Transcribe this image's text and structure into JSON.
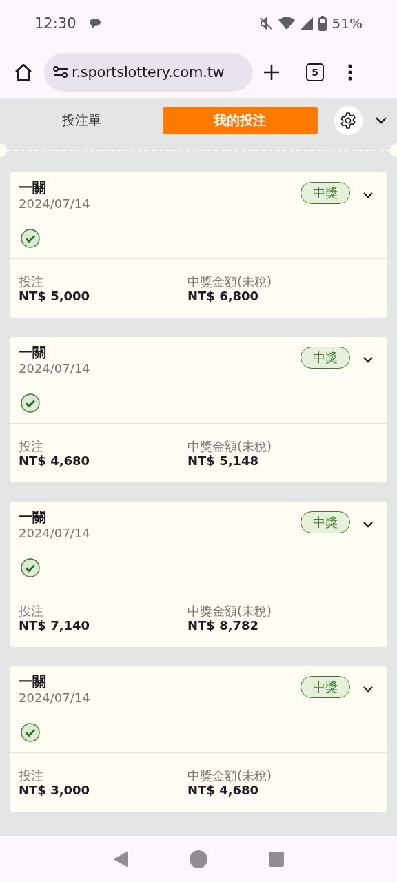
{
  "status_bar": {
    "time": "12:30",
    "battery": "51%"
  },
  "browser": {
    "url": "r.sportslottery.com.tw",
    "tab_count": "5"
  },
  "tabs": [
    {
      "label": "投注單",
      "selected": false
    },
    {
      "label": "我的投注",
      "selected": true
    }
  ],
  "bets": [
    {
      "title": "一關",
      "date": "2024/07/14",
      "status": "中獎",
      "stake_label": "投注",
      "stake": "NT$ 5,000",
      "payout_label": "中獎金額(未稅)",
      "payout": "NT$ 6,800"
    },
    {
      "title": "一關",
      "date": "2024/07/14",
      "status": "中獎",
      "stake_label": "投注",
      "stake": "NT$ 4,680",
      "payout_label": "中獎金額(未稅)",
      "payout": "NT$ 5,148"
    },
    {
      "title": "一關",
      "date": "2024/07/14",
      "status": "中獎",
      "stake_label": "投注",
      "stake": "NT$ 7,140",
      "payout_label": "中獎金額(未稅)",
      "payout": "NT$ 8,782"
    },
    {
      "title": "一關",
      "date": "2024/07/14",
      "status": "中獎",
      "stake_label": "投注",
      "stake": "NT$ 3,000",
      "payout_label": "中獎金額(未稅)",
      "payout": "NT$ 4,680"
    }
  ]
}
